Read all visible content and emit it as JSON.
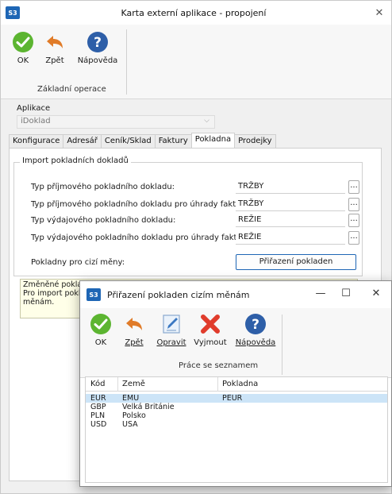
{
  "window": {
    "badge": "S3",
    "title": "Karta externí aplikace - propojení",
    "close": "✕"
  },
  "ribbon": {
    "ok": "OK",
    "back": "Zpět",
    "help": "Nápověda",
    "group_label": "Základní operace"
  },
  "application": {
    "label": "Aplikace",
    "value": "iDoklad"
  },
  "tabs": [
    "Konfigurace",
    "Adresář",
    "Ceník/Sklad",
    "Faktury",
    "Pokladna",
    "Prodejky"
  ],
  "active_tab": "Pokladna",
  "import_group": {
    "title": "Import pokladních dokladů",
    "rows": [
      {
        "label": "Typ příjmového pokladního dokladu:",
        "value": "TRŽBY"
      },
      {
        "label": "Typ příjmového pokladního dokladu pro úhrady faktur:",
        "value": "TRŽBY"
      },
      {
        "label": "Typ výdajového pokladního dokladu:",
        "value": "REŽIE"
      },
      {
        "label": "Typ výdajového pokladního dokladu pro úhrady faktur:",
        "value": "REŽIE"
      }
    ],
    "dots": "...",
    "foreign_label": "Pokladny pro cizí měny:",
    "assign_button": "Přiřazení pokladen"
  },
  "note": {
    "line1": "Změněné pokladní",
    "line2": "Pro import pokladn",
    "line3": "měnám."
  },
  "dialog": {
    "badge": "S3",
    "title": "Přiřazení pokladen cizím měnám",
    "min": "—",
    "max": "☐",
    "close": "✕",
    "ok": "OK",
    "back": "Zpět",
    "edit": "Opravit",
    "delete": "Vyjmout",
    "help": "Nápověda",
    "group_label": "Práce se seznamem",
    "columns": [
      "Kód",
      "Země",
      "Pokladna"
    ],
    "rows": [
      {
        "code": "EUR",
        "country": "EMU",
        "cash": "PEUR"
      },
      {
        "code": "GBP",
        "country": "Velká Británie",
        "cash": ""
      },
      {
        "code": "PLN",
        "country": "Polsko",
        "cash": ""
      },
      {
        "code": "USD",
        "country": "USA",
        "cash": ""
      }
    ]
  },
  "colors": {
    "accent": "#1e66b5",
    "ok_green": "#5cb531",
    "back_orange": "#e07b28",
    "help_blue": "#2e5fa8",
    "delete_red": "#e03c2c",
    "selection": "#cce4f7",
    "note_bg": "#ffffe8"
  },
  "icons": {
    "ok": "check-icon",
    "back": "back-arrow-icon",
    "help": "question-icon",
    "edit": "edit-icon",
    "delete": "delete-x-icon"
  }
}
